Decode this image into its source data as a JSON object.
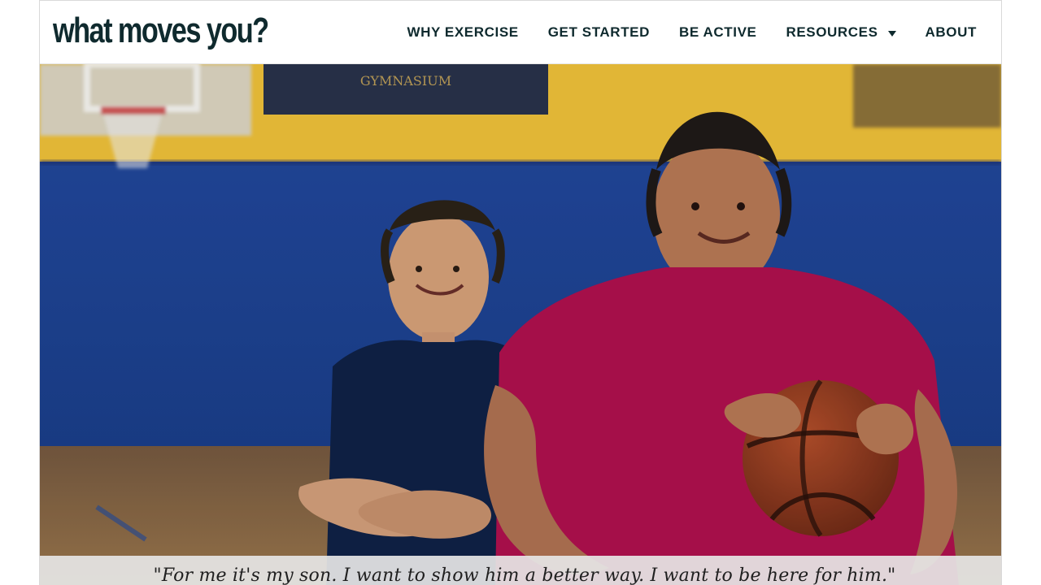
{
  "header": {
    "logo_text": "what moves you?"
  },
  "nav": {
    "items": [
      {
        "label": "WHY EXERCISE"
      },
      {
        "label": "GET STARTED"
      },
      {
        "label": "BE ACTIVE"
      },
      {
        "label": "RESOURCES",
        "has_dropdown": true,
        "icon": "caret-down-icon"
      },
      {
        "label": "ABOUT"
      }
    ]
  },
  "hero": {
    "image_description_role": "hero-photo",
    "scoreboard_text": "GYMNASIUM",
    "quote": "\"For me it's my son. I want to show him a better way. I want to be here for him.\""
  },
  "colors": {
    "brand_dark": "#0f2a2e",
    "quote_bar_bg": "#e6e6e6",
    "gym_wall_blue": "#1f4aa0",
    "gym_wall_yellow": "#f0c23a",
    "shirt_magenta": "#b0104e",
    "shirt_navy": "#0f2147"
  }
}
